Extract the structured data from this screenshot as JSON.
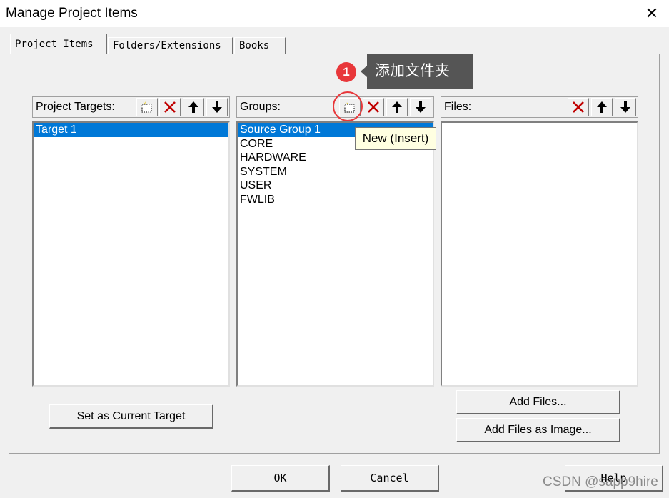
{
  "window": {
    "title": "Manage Project Items",
    "close_glyph": "✕"
  },
  "tabs": [
    {
      "label": "Project Items",
      "active": true
    },
    {
      "label": "Folders/Extensions",
      "active": false
    },
    {
      "label": "Books",
      "active": false
    }
  ],
  "targets": {
    "label": "Project Targets:",
    "items": [
      "Target 1"
    ],
    "selected": 0
  },
  "groups": {
    "label": "Groups:",
    "items": [
      "Source Group 1",
      "CORE",
      "HARDWARE",
      "SYSTEM",
      "USER",
      "FWLIB"
    ],
    "selected": 0
  },
  "files": {
    "label": "Files:",
    "items": []
  },
  "tooltip": {
    "text": "New (Insert)"
  },
  "annotation": {
    "badge": "1",
    "callout": "添加文件夹",
    "color": "#e8373a"
  },
  "buttons": {
    "set_current": "Set as Current Target",
    "add_files": "Add Files...",
    "add_files_image": "Add Files as Image...",
    "ok": "OK",
    "cancel": "Cancel",
    "help": "Help"
  },
  "watermark": "CSDN @sapp9hire",
  "icons": {
    "new": "new-folder-icon",
    "delete": "delete-x-icon",
    "up": "move-up-icon",
    "down": "move-down-icon"
  },
  "colors": {
    "selection": "#0078d7",
    "delete_red": "#c00000",
    "tooltip_bg": "#ffffe1"
  }
}
